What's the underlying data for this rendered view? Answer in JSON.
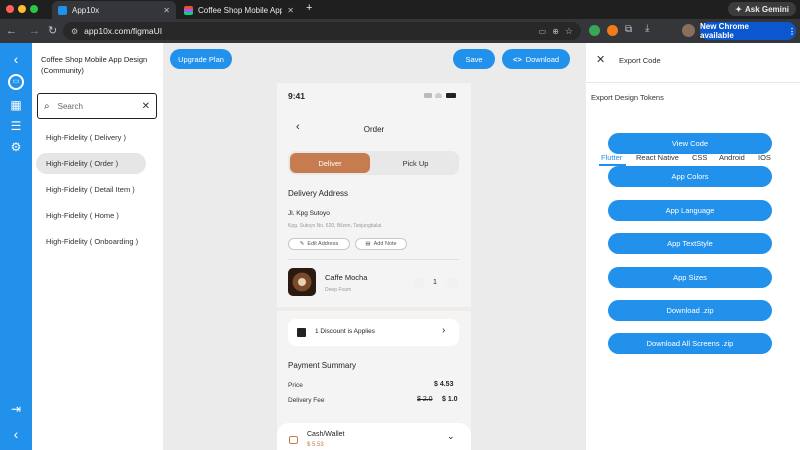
{
  "browser": {
    "tabs": [
      {
        "title": "App10x"
      },
      {
        "title": "Coffee Shop Mobile App Desi"
      }
    ],
    "new_tab": "+",
    "ask_gemini": "Ask Gemini",
    "url": "app10x.com/figmaUI",
    "update_button": "New Chrome available"
  },
  "sidebar": {
    "project_title": "Coffee Shop Mobile App Design (Community)",
    "search_placeholder": "Search",
    "items": [
      {
        "label": "High-Fidelity ( Delivery )",
        "active": false
      },
      {
        "label": "High-Fidelity ( Order )",
        "active": true
      },
      {
        "label": "High-Fidelity ( Detail Item )",
        "active": false
      },
      {
        "label": "High-Fidelity ( Home )",
        "active": false
      },
      {
        "label": "High-Fidelity ( Onboarding )",
        "active": false
      }
    ]
  },
  "canvas": {
    "upgrade_label": "Upgrade Plan",
    "save_label": "Save",
    "download_label": "Download"
  },
  "phone": {
    "time": "9:41",
    "screen_title": "Order",
    "toggle": {
      "selected": "Deliver",
      "other": "Pick Up"
    },
    "delivery_heading": "Delivery Address",
    "address_name": "Jl. Kpg Sutoyo",
    "address_detail": "Kpg. Sutoyo No. 620, Bilzen, Tanjungbalai.",
    "edit_address": "Edit Address",
    "add_note": "Add Note",
    "item_name": "Caffe Mocha",
    "item_variant": "Deep Foam",
    "item_qty": "1",
    "discount_label": "1 Discount is Applies",
    "payment_heading": "Payment Summary",
    "price_label": "Price",
    "price_value": "$ 4.53",
    "fee_label": "Delivery Fee",
    "fee_old": "$ 2.0",
    "fee_new": "$ 1.0",
    "wallet_label": "Cash/Wallet",
    "wallet_amount": "$ 5.53"
  },
  "export": {
    "title": "Export Code",
    "tokens_heading": "Export Design Tokens",
    "tabs": [
      "Flutter",
      "React Native",
      "CSS",
      "Android",
      "IOS"
    ],
    "active_tab": "Flutter",
    "buttons": [
      "View Code",
      "App Colors",
      "App Language",
      "App TextStyle",
      "App Sizes",
      "Download .zip",
      "Download All Screens .zip"
    ]
  },
  "colors": {
    "accent": "#2291ec",
    "coffee": "#c67c4e",
    "chrome_bg": "#1f1f1f"
  }
}
